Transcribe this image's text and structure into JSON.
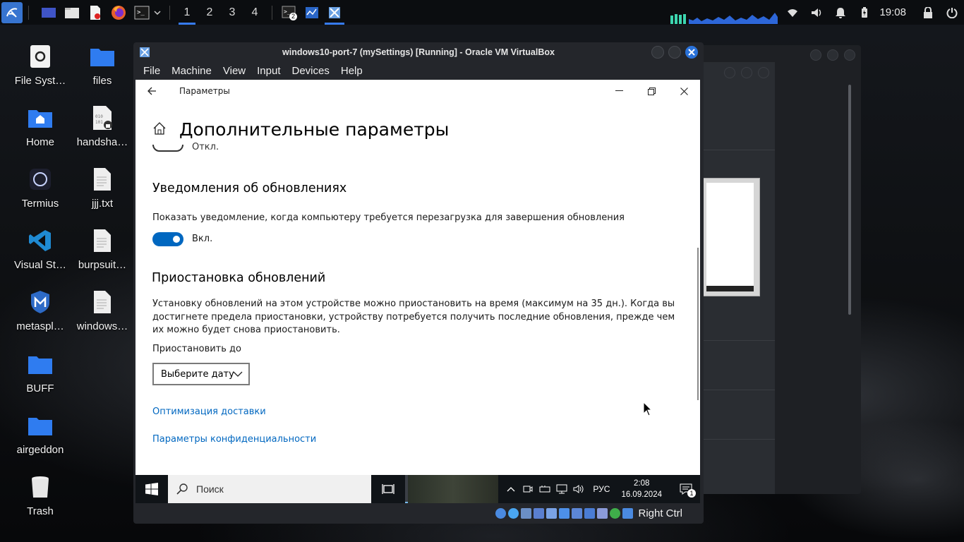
{
  "top_panel": {
    "workspaces": [
      "1",
      "2",
      "3",
      "4"
    ],
    "active_workspace": "1",
    "terminal_badge": "2",
    "clock": "19:08",
    "icons": [
      "kali-menu-icon",
      "show-desktop-icon",
      "file-manager-icon",
      "text-editor-icon",
      "firefox-icon",
      "terminal-icon",
      "terminal-dropdown-icon",
      "network-icon",
      "volume-icon",
      "notification-bell-icon",
      "battery-icon",
      "lock-icon",
      "power-icon"
    ]
  },
  "desktop_icons": {
    "col1": [
      "File Syst…",
      "Home",
      "Termius",
      "Visual St…",
      "metaspl…",
      "BUFF",
      "airgeddon",
      "Trash"
    ],
    "col2": [
      "files",
      "handsha…",
      "jjj.txt",
      "burpsuit…",
      "windows…"
    ]
  },
  "vbox": {
    "title": "windows10-port-7 (mySettings) [Running] - Oracle VM VirtualBox",
    "menu": [
      "File",
      "Machine",
      "View",
      "Input",
      "Devices",
      "Help"
    ],
    "status_right": "Right Ctrl"
  },
  "settings": {
    "app_title": "Параметры",
    "page_title": "Дополнительные параметры",
    "cut_off_toggle_label": "Откл.",
    "notifications_heading": "Уведомления об обновлениях",
    "notifications_desc": "Показать уведомление, когда компьютеру требуется перезагрузка для завершения обновления",
    "notifications_toggle_label": "Вкл.",
    "notifications_toggle_on": true,
    "pause_heading": "Приостановка обновлений",
    "pause_desc": "Установку обновлений на этом устройстве можно приостановить на время (максимум на 35 дн.). Когда вы достигнете предела приостановки, устройству потребуется получить последние обновления, прежде чем их можно будет снова приостановить.",
    "pause_until_label": "Приостановить до",
    "date_select_value": "Выберите дату",
    "link_delivery": "Оптимизация доставки",
    "link_privacy": "Параметры конфиденциальности"
  },
  "win_taskbar": {
    "search_placeholder": "Поиск",
    "lang": "РУС",
    "time": "2:08",
    "date": "16.09.2024",
    "notif_count": "1"
  },
  "colors": {
    "accent": "#0067c0",
    "kali_blue": "#367bf0",
    "vbox_close": "#2a72d9"
  }
}
